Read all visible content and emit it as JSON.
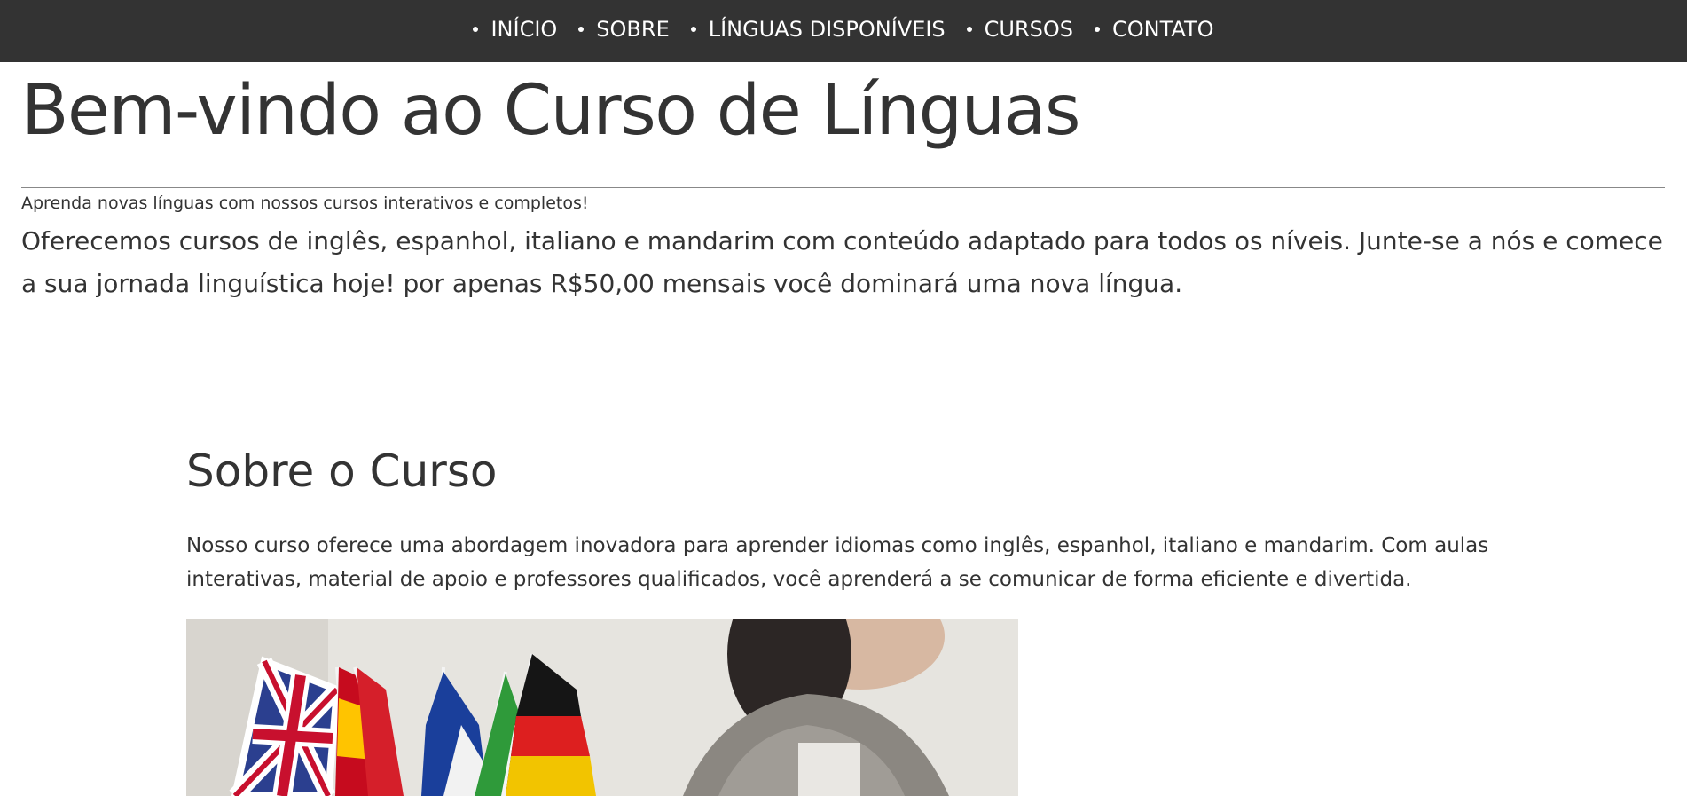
{
  "nav": {
    "items": [
      {
        "label": "INÍCIO"
      },
      {
        "label": "SOBRE"
      },
      {
        "label": "LÍNGUAS DISPONÍVEIS"
      },
      {
        "label": "CURSOS"
      },
      {
        "label": "CONTATO"
      }
    ]
  },
  "hero": {
    "title": "Bem-vindo ao Curso de Línguas",
    "tagline": "Aprenda novas línguas com nossos cursos interativos e completos!",
    "text": "Oferecemos cursos de inglês, espanhol, italiano e mandarim com conteúdo adaptado para todos os níveis. Junte-se a nós e comece a sua jornada linguística hoje! por apenas R$50,00 mensais você dominará uma nova língua."
  },
  "about": {
    "title": "Sobre o Curso",
    "text": "Nosso curso oferece uma abordagem inovadora para aprender idiomas como inglês, espanhol, italiano e mandarim. Com aulas interativas, material de apoio e professores qualificados, você aprenderá a se comunicar de forma eficiente e divertida."
  },
  "colors": {
    "navbar": "#333333",
    "text": "#333333",
    "background": "#ffffff"
  }
}
